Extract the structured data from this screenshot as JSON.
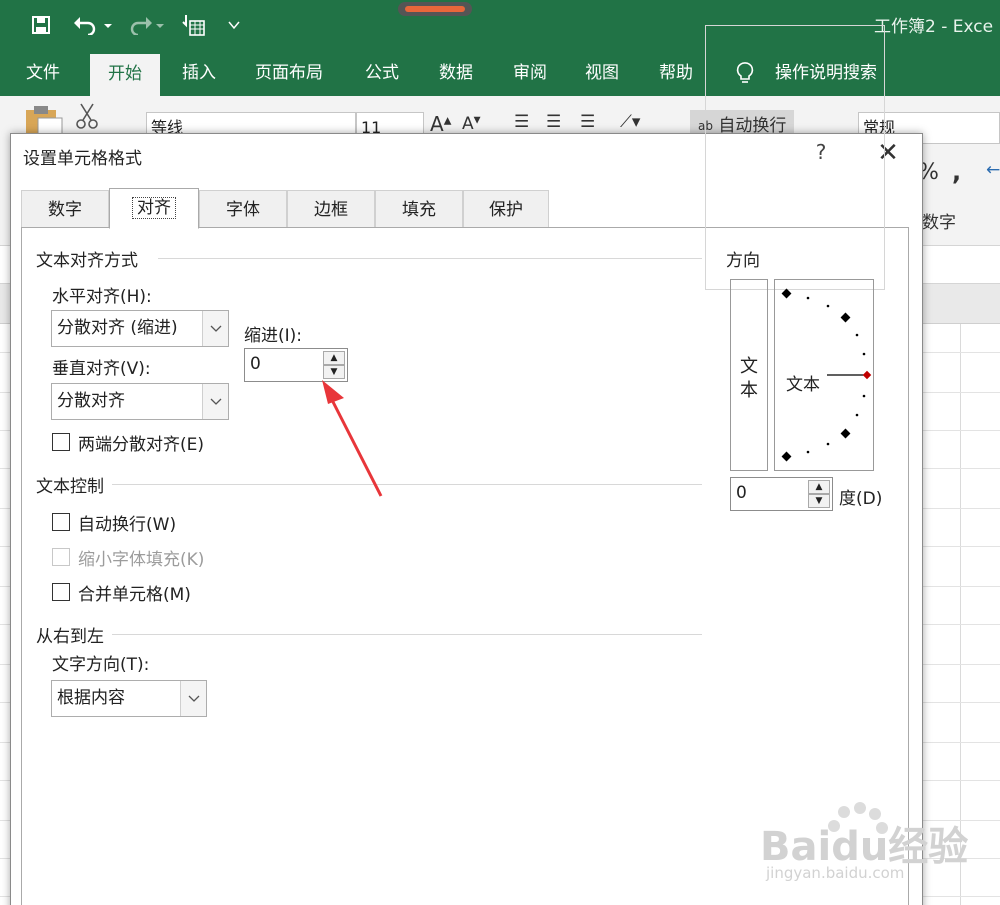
{
  "window": {
    "title": "工作簿2 - Exce"
  },
  "quick_access": {
    "save_icon": "save-icon",
    "undo_icon": "undo-icon",
    "redo_icon": "redo-icon",
    "format_painter_icon": "touch-mode-icon",
    "customize_icon": "customize-dropdown-icon"
  },
  "ribbon_tabs": [
    {
      "label": "文件"
    },
    {
      "label": "开始"
    },
    {
      "label": "插入"
    },
    {
      "label": "页面布局"
    },
    {
      "label": "公式"
    },
    {
      "label": "数据"
    },
    {
      "label": "审阅"
    },
    {
      "label": "视图"
    },
    {
      "label": "帮助"
    },
    {
      "label": "操作说明搜索"
    }
  ],
  "ribbon": {
    "font_name": "等线",
    "font_size": "11",
    "wrap_text": "自动换行",
    "number_format": "常规",
    "percent": "%",
    "comma": ",",
    "number_group": "数字"
  },
  "dialog": {
    "title": "设置单元格格式",
    "help": "?",
    "close": "✕",
    "tabs": [
      {
        "label": "数字"
      },
      {
        "label": "对齐"
      },
      {
        "label": "字体"
      },
      {
        "label": "边框"
      },
      {
        "label": "填充"
      },
      {
        "label": "保护"
      }
    ],
    "text_alignment": {
      "section": "文本对齐方式",
      "horizontal_label": "水平对齐(H):",
      "horizontal_value": "分散对齐 (缩进)",
      "indent_label": "缩进(I):",
      "indent_value": "0",
      "vertical_label": "垂直对齐(V):",
      "vertical_value": "分散对齐",
      "justify_distributed": "两端分散对齐(E)"
    },
    "text_control": {
      "section": "文本控制",
      "wrap": "自动换行(W)",
      "shrink": "缩小字体填充(K)",
      "merge": "合并单元格(M)"
    },
    "rtl": {
      "section": "从右到左",
      "direction_label": "文字方向(T):",
      "direction_value": "根据内容"
    },
    "orientation": {
      "section": "方向",
      "vertical_chars": [
        "文",
        "本"
      ],
      "dial_label": "文本",
      "degree_value": "0",
      "degree_label": "度(D)"
    }
  },
  "watermark": {
    "text": "Baidu经验",
    "url": "jingyan.baidu.com"
  },
  "colors": {
    "excel_green": "#217346",
    "arrow_red": "#e8363a",
    "dial_marker": "#c00000"
  }
}
